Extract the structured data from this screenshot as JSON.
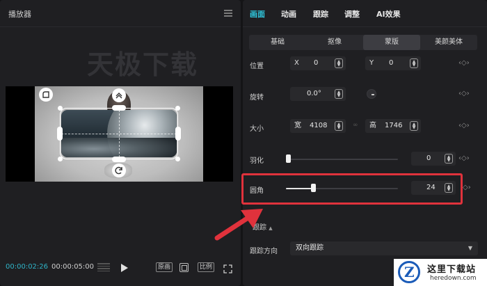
{
  "player": {
    "title": "播放器",
    "watermark": "天极下载",
    "time_current": "00:00:02:26",
    "time_total": "00:00:05:00",
    "btn_original": "原画",
    "btn_ratio": "比例"
  },
  "props": {
    "tabs": [
      "画面",
      "动画",
      "跟踪",
      "调整",
      "AI效果"
    ],
    "active_tab": "画面",
    "subtabs": [
      "基础",
      "抠像",
      "蒙版",
      "美颜美体"
    ],
    "active_subtab": "蒙版",
    "position": {
      "label": "位置",
      "x_prefix": "X",
      "x_value": "0",
      "y_prefix": "Y",
      "y_value": "0"
    },
    "rotation": {
      "label": "旋转",
      "value": "0.0°"
    },
    "size": {
      "label": "大小",
      "w_prefix": "宽",
      "w_value": "4108",
      "h_prefix": "高",
      "h_value": "1746"
    },
    "feather": {
      "label": "羽化",
      "value": "0",
      "percent": 0
    },
    "corner_radius": {
      "label": "圆角",
      "value": "24",
      "percent": 24
    },
    "tracking_section": "跟踪",
    "tracking_direction": {
      "label": "跟踪方向",
      "value": "双向跟踪"
    }
  },
  "logo": {
    "letter": "Z",
    "name": "这里下载站",
    "url": "heredown.com"
  },
  "colors": {
    "accent": "#2fc7de",
    "highlight": "#e0323c",
    "panel": "#1f1f22"
  }
}
